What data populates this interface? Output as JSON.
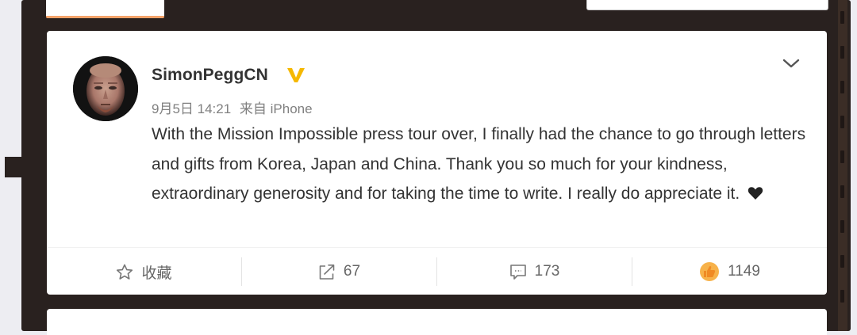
{
  "post": {
    "username": "SimonPeggCN",
    "date": "9月5日 14:21",
    "source_prefix": "来自",
    "source": "iPhone",
    "text": "With the Mission Impossible press tour over, I finally had the chance to go through letters and gifts from Korea, Japan and China. Thank you so much for your kindness, extraordinary generosity and for taking the time to write. I really do appreciate it.",
    "verified_badge_color": "#f5b800"
  },
  "actions": {
    "favorite_label": "收藏",
    "repost_count": "67",
    "comment_count": "173",
    "like_count": "1149"
  },
  "icons": {
    "verified": "verified-v-icon",
    "dropdown": "chevron-down-icon",
    "favorite": "star-outline-icon",
    "repost": "share-arrow-icon",
    "comment": "speech-bubble-icon",
    "like": "thumbs-up-icon",
    "emoji": "black-heart-icon"
  },
  "colors": {
    "like_accent": "#f5a623",
    "frame": "#29211f",
    "tab_highlight": "#f5a36a"
  }
}
